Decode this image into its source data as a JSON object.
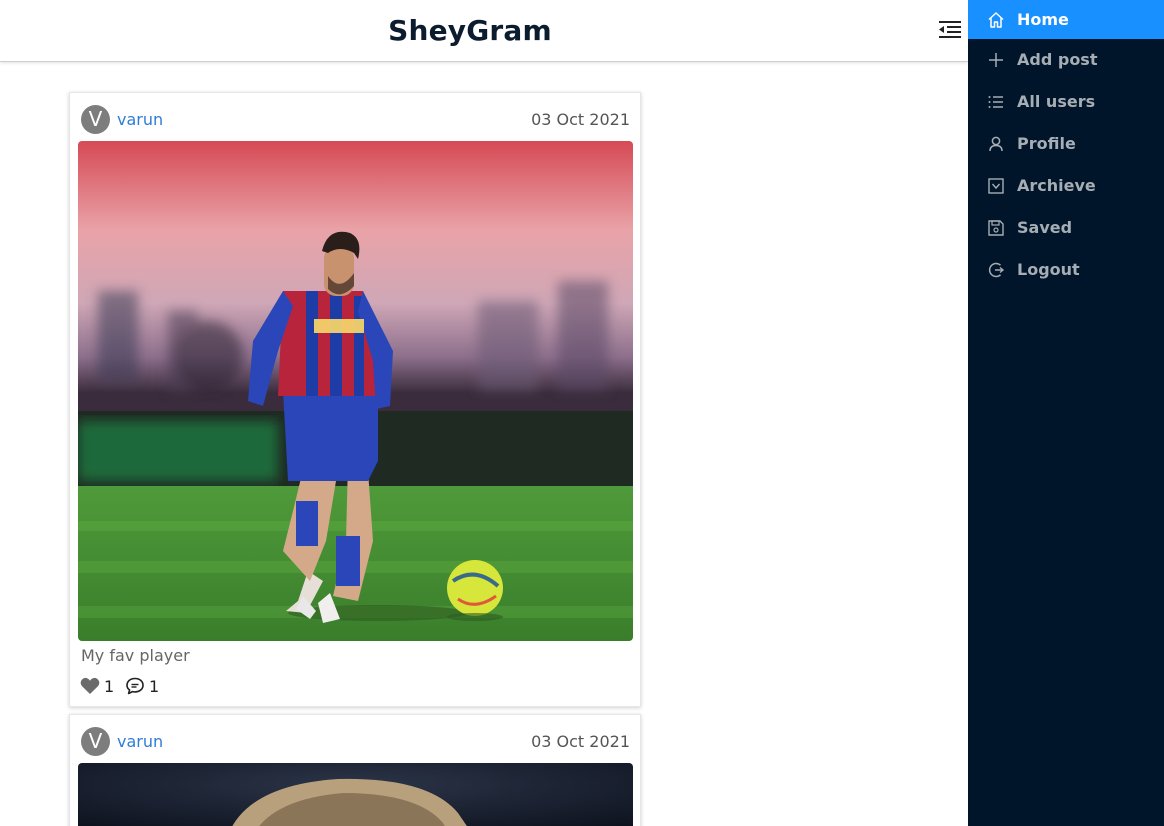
{
  "header": {
    "brand": "SheyGram"
  },
  "sidebar": {
    "items": [
      {
        "label": "Home",
        "icon": "home-icon",
        "active": true
      },
      {
        "label": "Add post",
        "icon": "plus-icon"
      },
      {
        "label": "All users",
        "icon": "list-icon"
      },
      {
        "label": "Profile",
        "icon": "user-icon"
      },
      {
        "label": "Archieve",
        "icon": "check-square-icon"
      },
      {
        "label": "Saved",
        "icon": "save-icon"
      },
      {
        "label": "Logout",
        "icon": "logout-icon"
      }
    ]
  },
  "posts": [
    {
      "avatar_letter": "V",
      "user": "varun",
      "date": "03 Oct 2021",
      "caption": "My fav player",
      "likes": "1",
      "comments": "1"
    },
    {
      "avatar_letter": "V",
      "user": "varun",
      "date": "03 Oct 2021"
    }
  ],
  "colors": {
    "sidebar_bg": "#001529",
    "active_bg": "#1890ff",
    "link": "#2f7dd6"
  }
}
